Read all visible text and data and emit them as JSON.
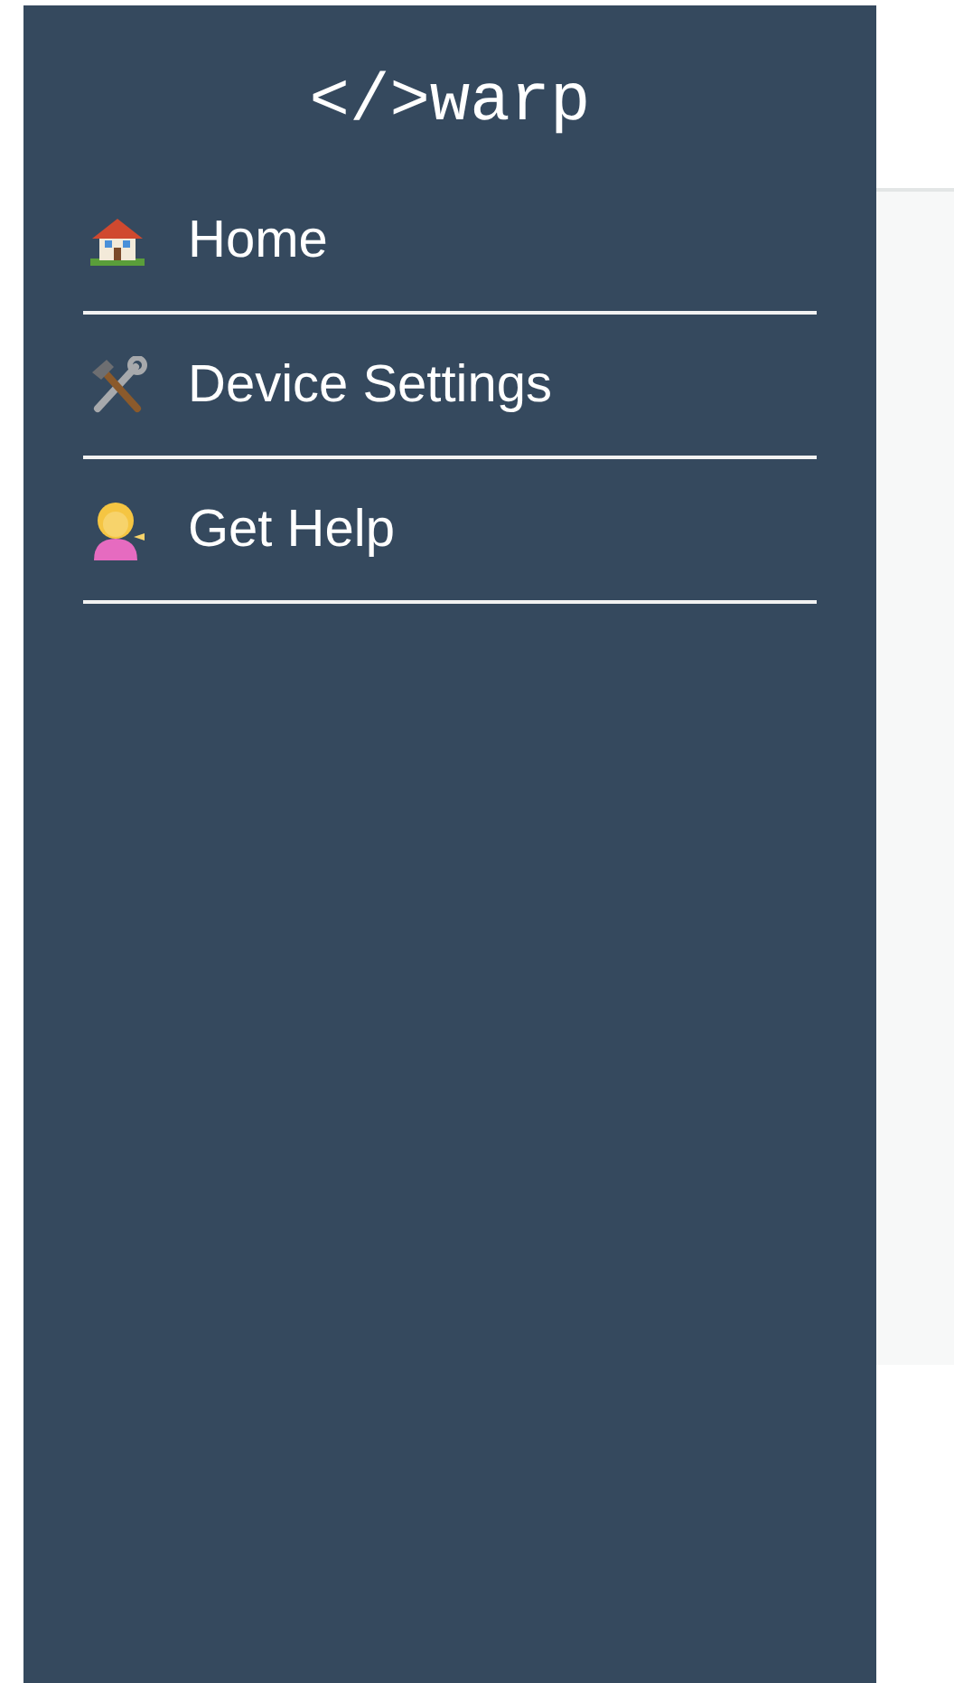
{
  "drawer": {
    "logo": "</>warp",
    "items": [
      {
        "kind": "home",
        "label": "Home"
      },
      {
        "kind": "tools",
        "label": "Device Settings"
      },
      {
        "kind": "help",
        "label": "Get Help"
      }
    ]
  }
}
